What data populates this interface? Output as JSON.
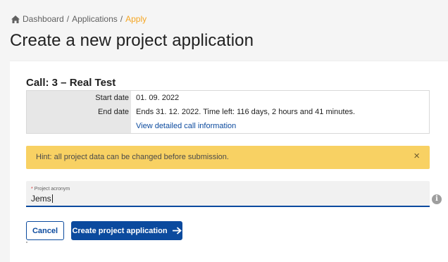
{
  "breadcrumb": {
    "home_icon": "home-icon",
    "items": [
      "Dashboard",
      "Applications",
      "Apply"
    ],
    "separator": "/"
  },
  "page": {
    "title": "Create a new project application"
  },
  "call": {
    "title": "Call: 3 – Real Test",
    "start_date_label": "Start date",
    "start_date_value": "01. 09. 2022",
    "end_date_label": "End date",
    "end_date_value": "Ends 31. 12. 2022. Time left: 116 days, 2 hours and 41 minutes.",
    "details_link": "View detailed call information"
  },
  "hint": {
    "text": "Hint: all project data can be changed before submission.",
    "close_label": "×"
  },
  "form": {
    "acronym_required_mark": "*",
    "acronym_label": "Project acronym",
    "acronym_value": "Jems",
    "info_icon": "i"
  },
  "actions": {
    "cancel_label": "Cancel",
    "create_label": "Create project application"
  },
  "colors": {
    "primary": "#0b4a9e",
    "accent": "#f5a623",
    "hint_bg": "#f8d163"
  }
}
